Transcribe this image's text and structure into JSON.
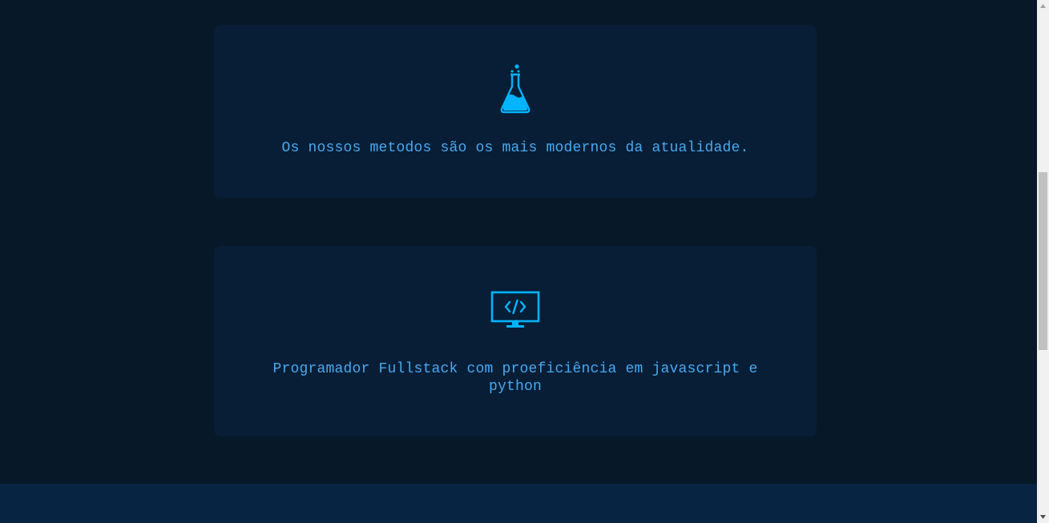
{
  "cards": [
    {
      "icon": "flask-icon",
      "text": "Os nossos metodos são os mais modernos da atualidade."
    },
    {
      "icon": "code-monitor-icon",
      "text": "Programador Fullstack com proeficiência em javascript e python"
    }
  ],
  "colors": {
    "page_background": "#071828",
    "card_background": "#071e36",
    "accent": "#00b4ff",
    "text": "#49a9f0",
    "footer": "#072542"
  },
  "scrollbar": {
    "up_icon": "scroll-up-arrow-icon",
    "down_icon": "scroll-down-arrow-icon"
  }
}
